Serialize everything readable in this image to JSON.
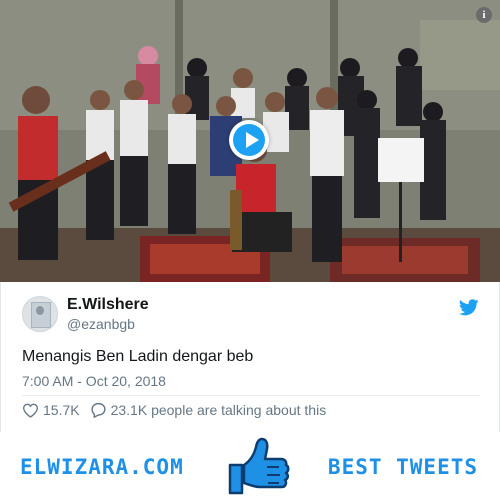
{
  "tweet": {
    "author_name": "E.Wilshere",
    "author_handle": "@ezanbgb",
    "text": "Menangis Ben Ladin dengar beb",
    "timestamp": "7:00 AM - Oct 20, 2018",
    "likes": "15.7K",
    "talking": "23.1K people are talking about this"
  },
  "footer": {
    "left_brand": "ELWIZARA.COM",
    "right_brand": "BEST TWEETS"
  },
  "icons": {
    "info": "i",
    "play": "play-icon",
    "bird": "twitter-bird-icon",
    "heart": "heart-icon",
    "reply": "speech-bubble-icon",
    "thumb": "thumbs-up-icon"
  },
  "colors": {
    "accent": "#1da1f2",
    "brand_text": "#1e90e6",
    "muted": "#657786",
    "text": "#14171a"
  }
}
